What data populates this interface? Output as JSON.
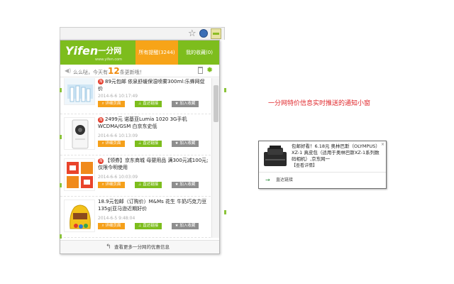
{
  "popup": {
    "logo_text": "Yifen",
    "logo_cn": "一分网",
    "logo_sub": "www.yifen.com",
    "tabs": [
      {
        "label": "所有提醒(3244)"
      },
      {
        "label": "我的收藏(0)"
      }
    ],
    "notice": {
      "prefix": "么么哒，今天有",
      "count": "12",
      "suffix": "条更新哦！"
    },
    "items": [
      {
        "badge": "淘",
        "title": "89元包邮 依泉舒缓保湿喷雾300ml:乐蜂网促价",
        "time": "2014-6-6 10:17:49"
      },
      {
        "badge": "淘",
        "title": "2499元 诺基亚Lumia 1020 3G手机 WCDMA/GSM 白京东史低",
        "time": "2014-6-6 10:13:09"
      },
      {
        "badge": "淘",
        "title": "【领券】京东商城 母婴用品 满300元减100元;仅限今明使用",
        "time": "2014-6-6 10:03:09"
      },
      {
        "badge": "",
        "title": "18.9元包邮（订购价）M&Ms 花生 牛奶巧克力豆 135g|亚马逊近期好价",
        "time": "2014-6-5 9:48:04"
      }
    ],
    "buttons": {
      "detail": "详细页面",
      "direct": "直达链接",
      "fav": "加入收藏"
    },
    "footer": "查看更多一分网的优惠信息"
  },
  "caption": "一分网特价信息实时推送的通知小窗",
  "notification": {
    "text": "包邮好看！6.18元 奥林巴斯（OLYMPUS） XZ-1 真皮包（适用于奥林巴斯XZ-1系列数码相机）,京东网一",
    "more": "【查看详情】",
    "close": "×",
    "link": "直达链接"
  },
  "colors": {
    "brand_green": "#7dbd1d",
    "tab_orange": "#f7a418",
    "caption_red": "#e0262a"
  }
}
